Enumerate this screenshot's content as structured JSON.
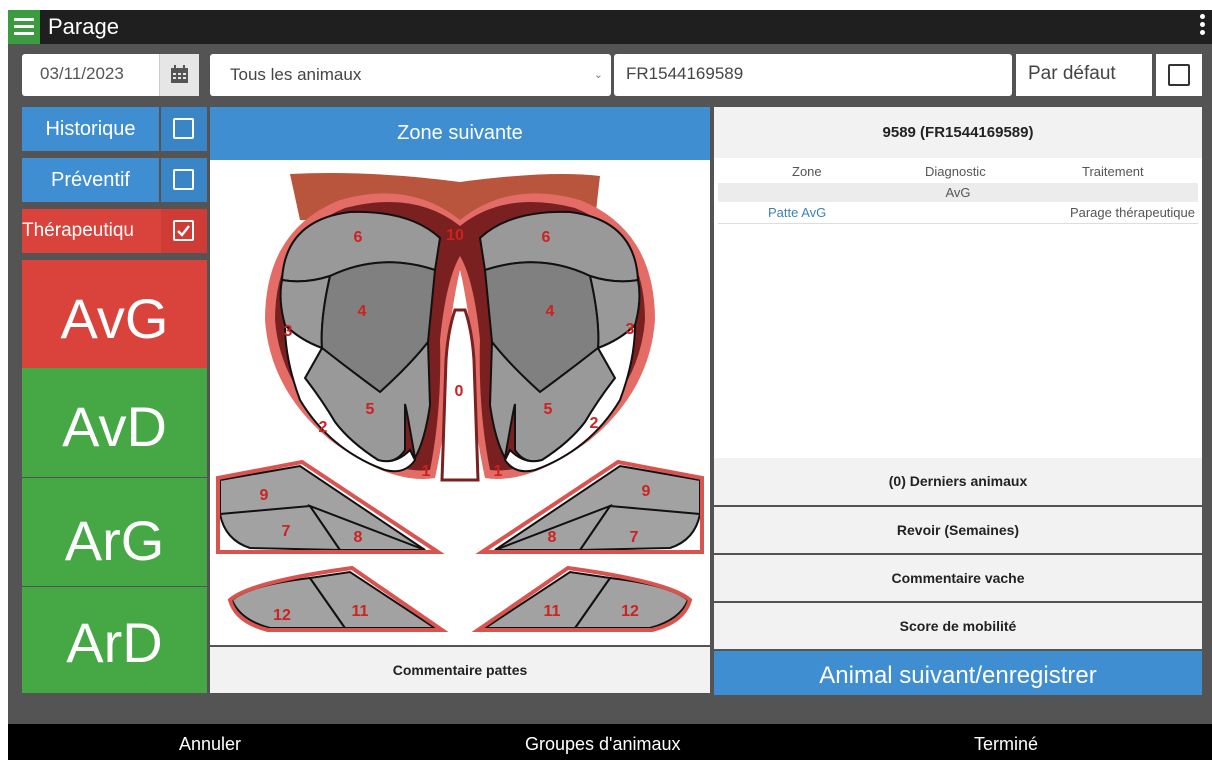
{
  "app": {
    "title": "Parage"
  },
  "toolbar": {
    "date": "03/11/2023",
    "animal_filter": "Tous les animaux",
    "animal_id": "FR1544169589",
    "default_label": "Par défaut",
    "default_checked": false
  },
  "filters": [
    {
      "label": "Historique",
      "checked": false
    },
    {
      "label": "Préventif",
      "checked": false
    },
    {
      "label": "Thérapeutiqu",
      "checked": true
    }
  ],
  "legs": [
    {
      "label": "AvG",
      "color": "#d9433c",
      "selected": true
    },
    {
      "label": "AvD",
      "color": "#45a845",
      "selected": false
    },
    {
      "label": "ArG",
      "color": "#45a845",
      "selected": false
    },
    {
      "label": "ArD",
      "color": "#45a845",
      "selected": false
    }
  ],
  "center": {
    "next_zone": "Zone suivante",
    "comment_paws": "Commentaire pattes",
    "zones": {
      "z10": "10",
      "z6": "6",
      "z4": "4",
      "z3": "3",
      "z5": "5",
      "z2": "2",
      "z0": "0",
      "z1": "1",
      "z9": "9",
      "z7": "7",
      "z8": "8",
      "z12": "12",
      "z11": "11"
    }
  },
  "right": {
    "animal_header": "9589 (FR1544169589)",
    "columns": [
      "Zone",
      "Diagnostic",
      "Traitement"
    ],
    "group": "AvG",
    "rows": [
      {
        "zone": "Patte AvG",
        "diagnostic": "",
        "treatment": "Parage thérapeutique"
      }
    ],
    "actions": {
      "last_animals": "(0) Derniers animaux",
      "review": "Revoir (Semaines)",
      "cow_comment": "Commentaire vache",
      "mobility": "Score de mobilité",
      "next_animal": "Animal suivant/enregistrer"
    }
  },
  "bottom": {
    "cancel": "Annuler",
    "groups": "Groupes d'animaux",
    "done": "Terminé"
  },
  "colors": {
    "blue": "#3f8ed2",
    "red": "#d9433c",
    "green": "#45a845",
    "dark": "#1f1f1f"
  }
}
